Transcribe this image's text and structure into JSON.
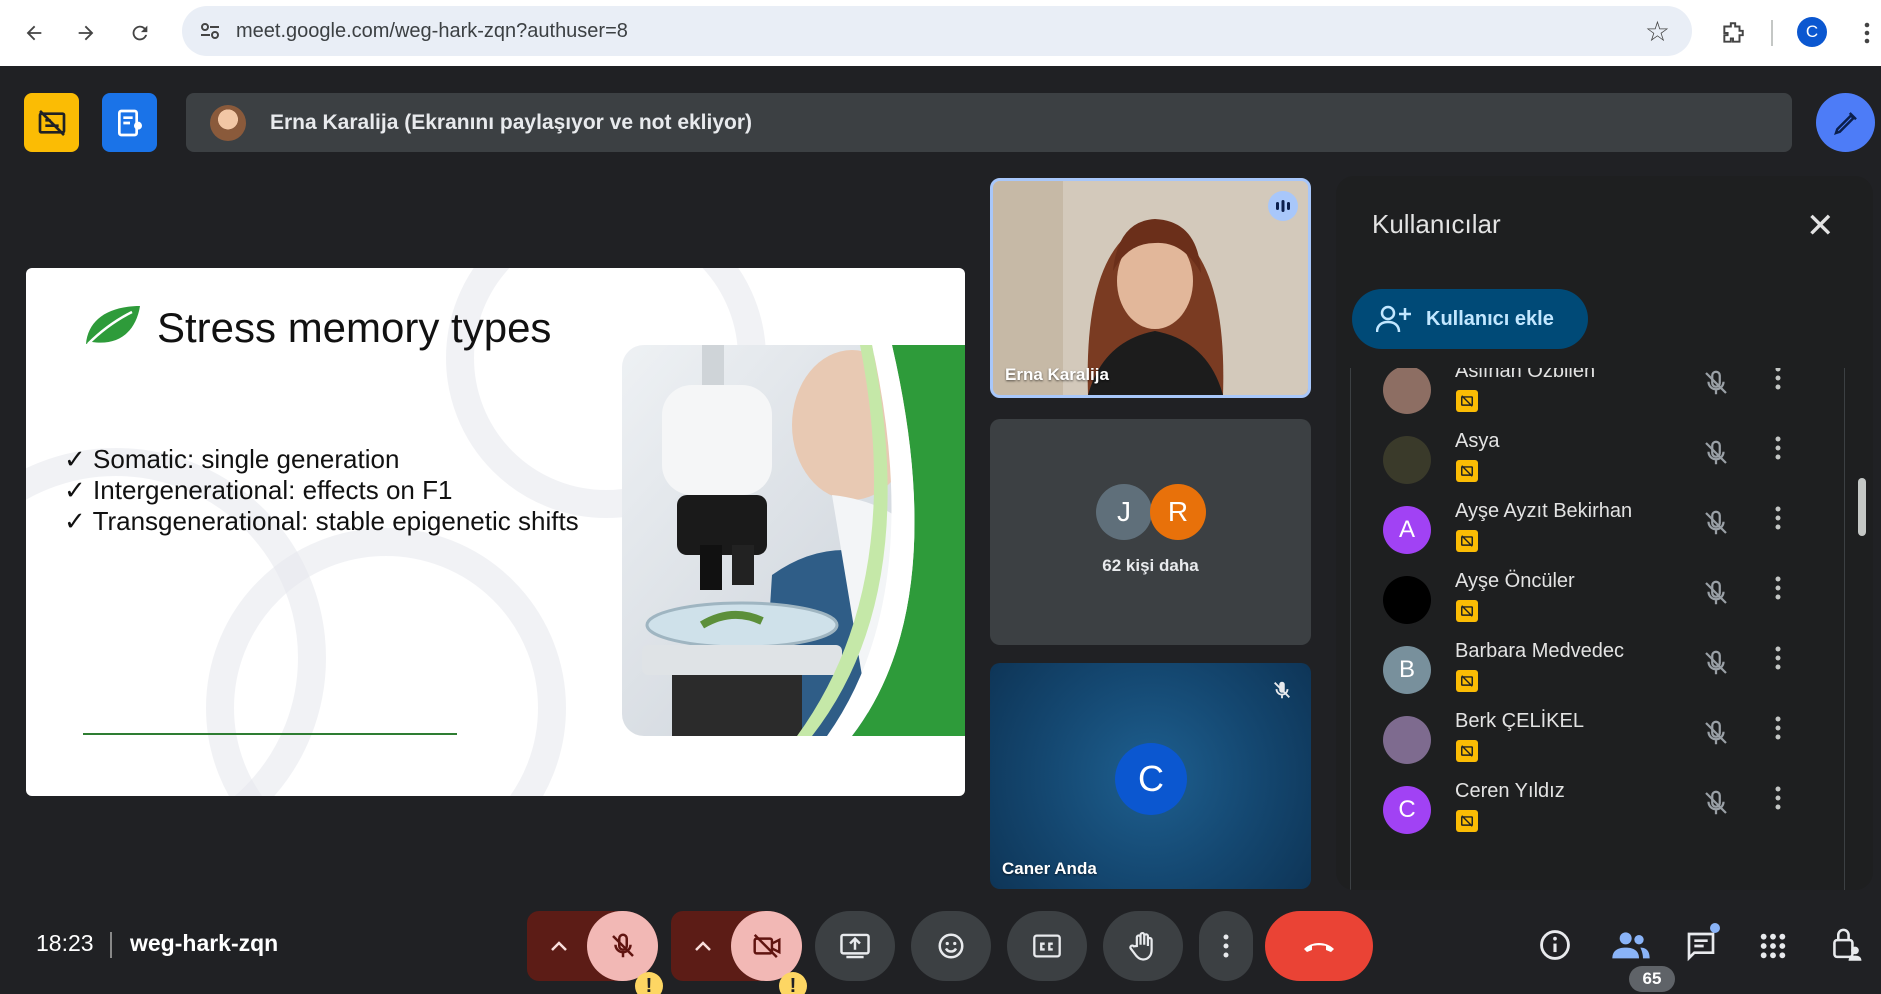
{
  "browser": {
    "url": "meet.google.com/weg-hark-zqn?authuser=8",
    "profile_initial": "C"
  },
  "meet": {
    "presenter_banner": "Erna Karalija (Ekranını paylaşıyor ve not ekliyor)",
    "slide": {
      "title": "Stress memory types",
      "bullets": [
        "Somatic: single generation",
        "Intergenerational: effects on F1",
        "Transgenerational: stable epigenetic shifts"
      ],
      "check": "✓"
    },
    "tiles": {
      "presenter_name": "Erna Karalija",
      "more_initial_1": "J",
      "more_initial_2": "R",
      "more_text": "62 kişi daha",
      "self_initial": "C",
      "self_name": "Caner Anda"
    },
    "panel": {
      "title": "Kullanıcılar",
      "add_label": "Kullanıcı ekle",
      "people": [
        {
          "name": "Aslıhan Özbilen",
          "initial": "",
          "color": "#8d6e63"
        },
        {
          "name": "Asya",
          "initial": "",
          "color": "#3a3a2a"
        },
        {
          "name": "Ayşe Ayzıt Bekirhan",
          "initial": "A",
          "color": "#a142f4"
        },
        {
          "name": "Ayşe Öncüler",
          "initial": "",
          "color": "#000000"
        },
        {
          "name": "Barbara Medvedec",
          "initial": "B",
          "color": "#78909c"
        },
        {
          "name": "Berk ÇELİKEL",
          "initial": "",
          "color": "#7e6b8f"
        },
        {
          "name": "Ceren Yıldız",
          "initial": "C",
          "color": "#a142f4"
        }
      ]
    },
    "footer": {
      "time": "18:23",
      "meeting_code": "weg-hark-zqn",
      "participant_count": "65",
      "warning_mark": "!"
    },
    "colors": {
      "accent_blue": "#1a73e8",
      "hangup_red": "#ea4335",
      "warning_yellow": "#fdd663",
      "badge_yellow": "#fbbc04"
    }
  }
}
